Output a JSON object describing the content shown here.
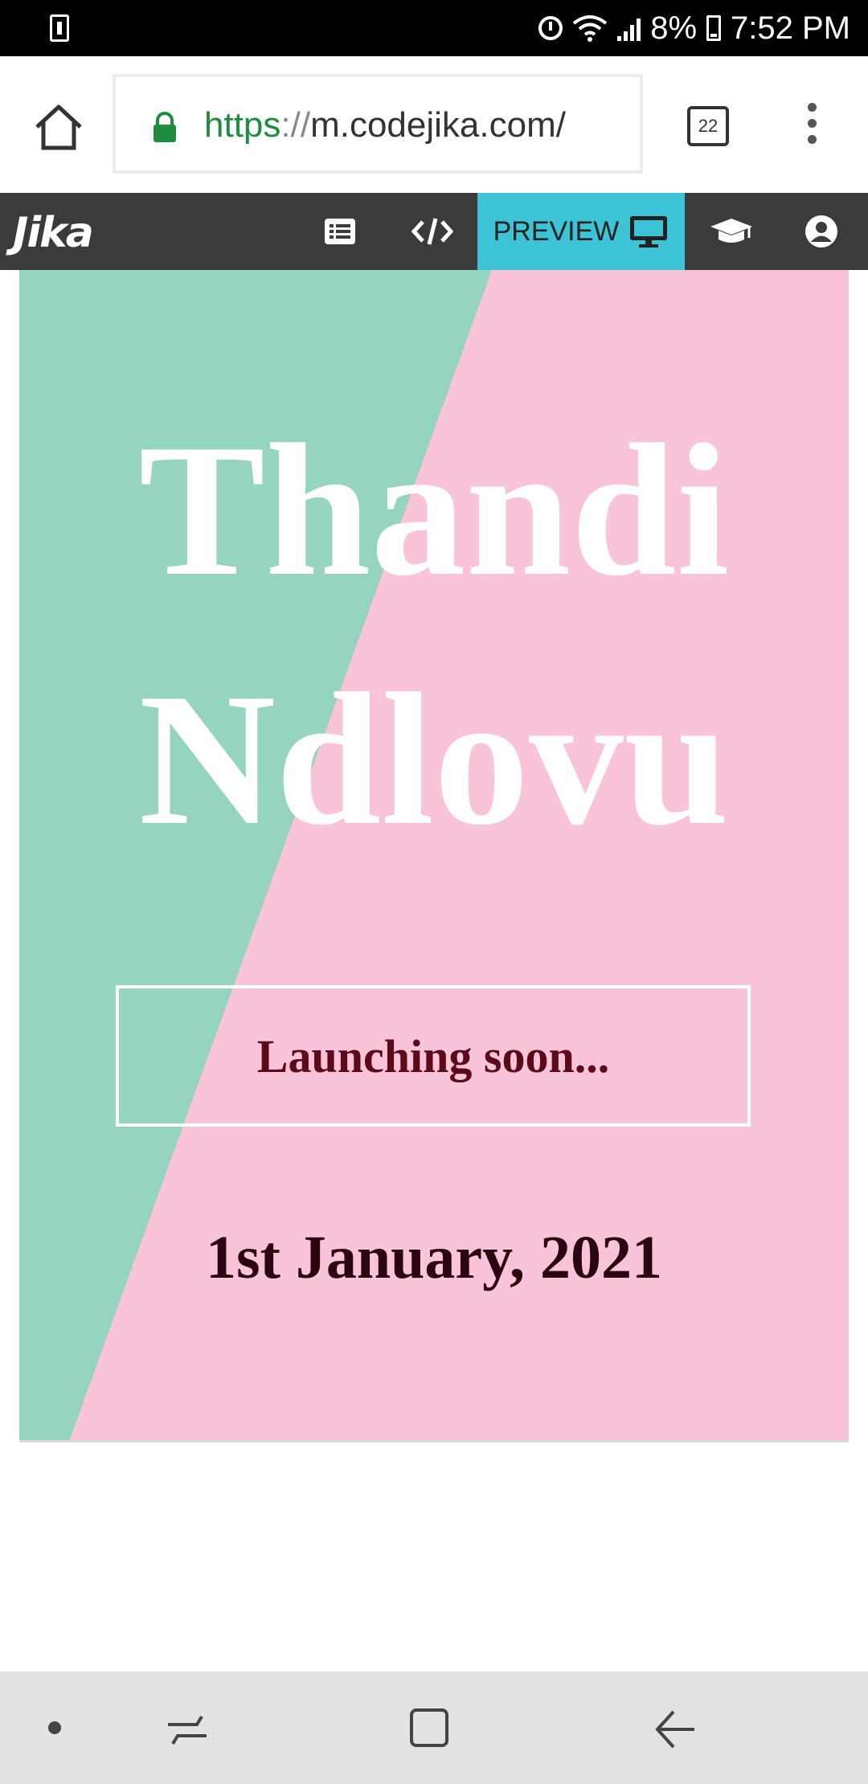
{
  "status_bar": {
    "battery_percent": "8%",
    "time": "7:52 PM"
  },
  "browser": {
    "url_scheme": "https",
    "url_separator": "://",
    "url_host": "m.codejika.com/",
    "tab_count": "22"
  },
  "app_bar": {
    "logo_text": "Jika",
    "active_tab_label": "PREVIEW",
    "icons": [
      "list-icon",
      "code-icon",
      "monitor-icon",
      "graduation-cap-icon",
      "user-icon"
    ]
  },
  "preview": {
    "first_name": "Thandi",
    "last_name": "Ndlovu",
    "launch_label": "Launching soon...",
    "launch_date": "1st January, 2021",
    "colors": {
      "mint": "#95d5be",
      "pink": "#f9c4d9",
      "launch_text": "#5c0a1a",
      "date_text": "#2a0710"
    }
  },
  "colors": {
    "status_bar": "#000000",
    "app_bar": "#3b3b3b",
    "preview_tab": "#3cc3d5",
    "url_green": "#1e8e3e"
  }
}
